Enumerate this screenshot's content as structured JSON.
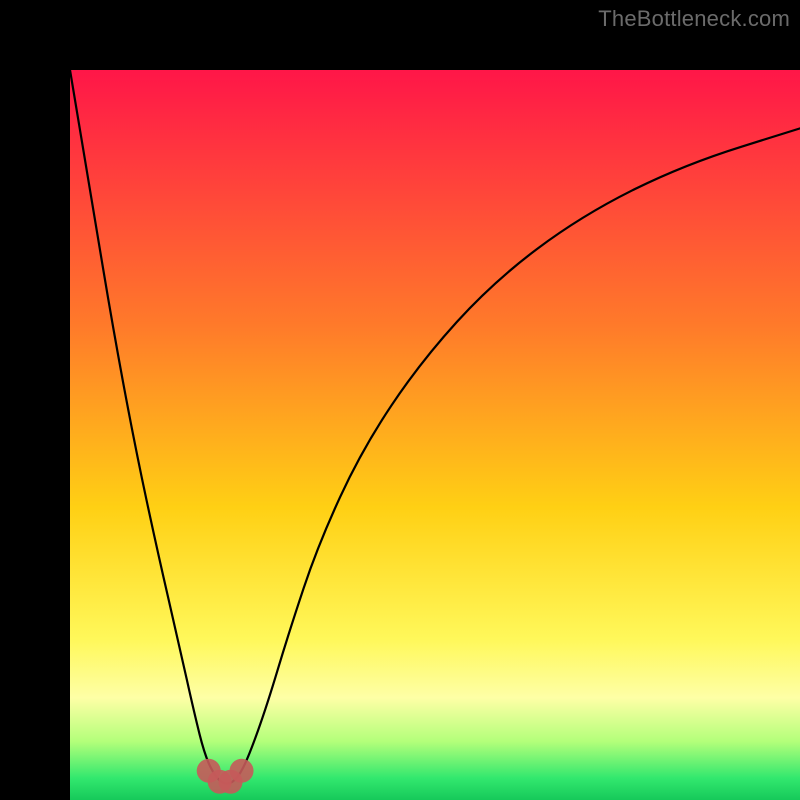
{
  "watermark": "TheBottleneck.com",
  "chart_data": {
    "type": "line",
    "title": "",
    "xlabel": "",
    "ylabel": "",
    "xlim": [
      0,
      100
    ],
    "ylim": [
      0,
      100
    ],
    "grid": false,
    "legend": false,
    "gradient_stops": [
      {
        "offset": 0.0,
        "color": "#ff1648"
      },
      {
        "offset": 0.35,
        "color": "#ff7a2a"
      },
      {
        "offset": 0.6,
        "color": "#ffd014"
      },
      {
        "offset": 0.78,
        "color": "#fff85a"
      },
      {
        "offset": 0.86,
        "color": "#feffa6"
      },
      {
        "offset": 0.92,
        "color": "#b3ff7a"
      },
      {
        "offset": 0.97,
        "color": "#32e86e"
      },
      {
        "offset": 1.0,
        "color": "#16c95a"
      }
    ],
    "series": [
      {
        "name": "bottleneck-curve",
        "x": [
          0,
          3,
          6,
          9,
          12,
          15,
          17,
          18.5,
          20,
          21.5,
          23,
          24.5,
          27,
          30,
          34,
          40,
          48,
          58,
          70,
          84,
          100
        ],
        "values": [
          100,
          82,
          64,
          48,
          34,
          21,
          12,
          6,
          3,
          2,
          3,
          6,
          13,
          23,
          35,
          48,
          60,
          71,
          80,
          87,
          92
        ]
      }
    ],
    "marker_cluster": {
      "color": "#c55a5a",
      "radius": 12,
      "points": [
        {
          "x": 19.0,
          "y": 4.0
        },
        {
          "x": 20.5,
          "y": 2.5
        },
        {
          "x": 22.0,
          "y": 2.5
        },
        {
          "x": 23.5,
          "y": 4.0
        }
      ]
    }
  }
}
